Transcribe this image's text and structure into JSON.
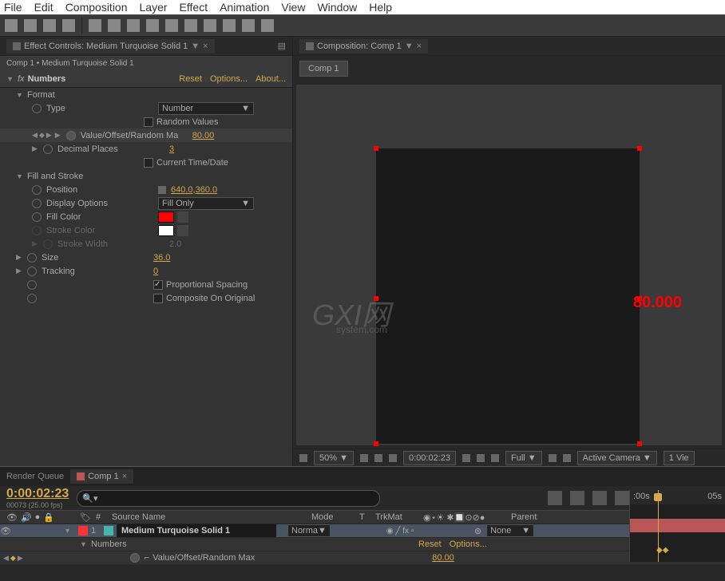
{
  "menu": [
    "File",
    "Edit",
    "Composition",
    "Layer",
    "Effect",
    "Animation",
    "View",
    "Window",
    "Help"
  ],
  "effectPanel": {
    "tabTitle": "Effect Controls: Medium Turquoise Solid 1",
    "subtitle": "Comp 1 • Medium Turquoise Solid 1",
    "fxName": "Numbers",
    "reset": "Reset",
    "options": "Options...",
    "about": "About...",
    "sections": {
      "format": "Format",
      "fillStroke": "Fill and Stroke"
    },
    "props": {
      "type": {
        "label": "Type",
        "value": "Number"
      },
      "randomValues": {
        "label": "Random Values"
      },
      "valueOffset": {
        "label": "Value/Offset/Random Ma",
        "value": "80.00"
      },
      "decimalPlaces": {
        "label": "Decimal Places",
        "value": "3"
      },
      "currentTime": {
        "label": "Current Time/Date"
      },
      "position": {
        "label": "Position",
        "value": "640.0,360.0"
      },
      "displayOptions": {
        "label": "Display Options",
        "value": "Fill Only"
      },
      "fillColor": {
        "label": "Fill Color"
      },
      "strokeColor": {
        "label": "Stroke Color"
      },
      "strokeWidth": {
        "label": "Stroke Width",
        "value": "2.0"
      },
      "size": {
        "label": "Size",
        "value": "36.0"
      },
      "tracking": {
        "label": "Tracking",
        "value": "0"
      },
      "propSpacing": {
        "label": "Proportional Spacing"
      },
      "compOnOrig": {
        "label": "Composite On Original"
      }
    }
  },
  "compPanel": {
    "tabTitle": "Composition: Comp 1",
    "tabBtn": "Comp 1",
    "displayNumber": "80.000",
    "footer": {
      "zoom": "50%",
      "time": "0:00:02:23",
      "res": "Full",
      "camera": "Active Camera",
      "view": "1 Vie"
    }
  },
  "timeline": {
    "renderQueue": "Render Queue",
    "compTab": "Comp 1",
    "timecode": "0:00:02:23",
    "frameInfo": "00073 (25.00 fps)",
    "columns": {
      "num": "#",
      "source": "Source Name",
      "mode": "Mode",
      "t": "T",
      "trkMat": "TrkMat",
      "parent": "Parent"
    },
    "layer": {
      "num": "1",
      "name": "Medium Turquoise Solid 1",
      "mode": "Norma",
      "parent": "None"
    },
    "fxRow": {
      "name": "Numbers",
      "reset": "Reset",
      "options": "Options..."
    },
    "propRow": {
      "name": "Value/Offset/Random Max",
      "value": "80.00"
    },
    "ruler": {
      "t0": ":00s",
      "t1": "05s"
    }
  }
}
